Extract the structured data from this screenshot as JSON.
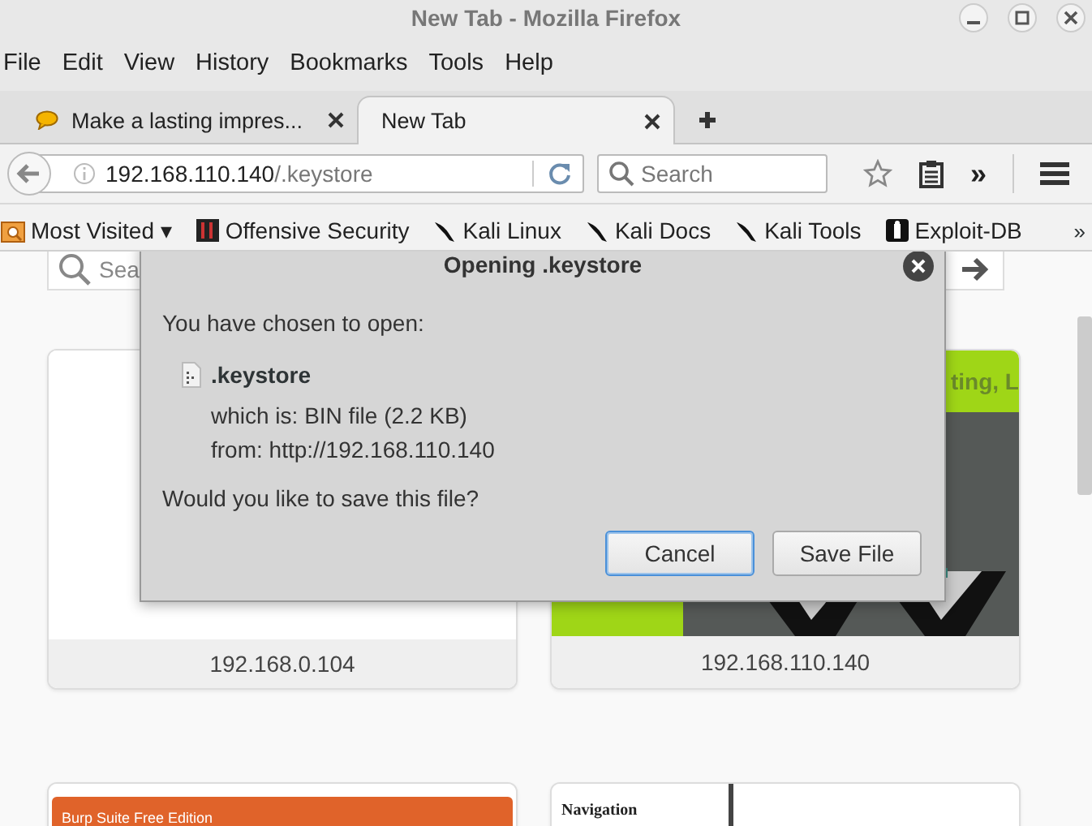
{
  "window": {
    "title": "New Tab - Mozilla Firefox"
  },
  "menu": [
    "File",
    "Edit",
    "View",
    "History",
    "Bookmarks",
    "Tools",
    "Help"
  ],
  "tabs": [
    {
      "label": "Make a lasting impres...",
      "selected": false
    },
    {
      "label": "New Tab",
      "selected": true
    }
  ],
  "address_bar": {
    "host": "192.168.110.140",
    "path": "/.keystore"
  },
  "search": {
    "placeholder": "Search"
  },
  "toolbar_overflow": "»",
  "bookmarks": [
    {
      "label": "Most Visited ▾",
      "kind": "folder"
    },
    {
      "label": "Offensive Security",
      "kind": "offsec"
    },
    {
      "label": "Kali Linux",
      "kind": "kali"
    },
    {
      "label": "Kali Docs",
      "kind": "kali"
    },
    {
      "label": "Kali Tools",
      "kind": "kali"
    },
    {
      "label": "Exploit-DB",
      "kind": "exploit"
    }
  ],
  "bookmarks_overflow": "»",
  "content": {
    "search_placeholder": "Sea",
    "tiles": [
      {
        "kind": "blank",
        "caption": "192.168.0.104"
      },
      {
        "kind": "site",
        "caption": "192.168.110.140",
        "header_text": "ting, L"
      },
      {
        "kind": "burp",
        "header_text": "Burp Suite Free Edition"
      },
      {
        "kind": "nav",
        "header_text": "Navigation"
      }
    ]
  },
  "dialog": {
    "title": "Opening .keystore",
    "intro": "You have chosen to open:",
    "file_name": ".keystore",
    "file_type": "which is: BIN file (2.2 KB)",
    "source": "from: http://192.168.110.140",
    "question": "Would you like to save this file?",
    "buttons": [
      {
        "label": "Cancel",
        "focused": true
      },
      {
        "label": "Save File",
        "focused": false
      }
    ]
  }
}
